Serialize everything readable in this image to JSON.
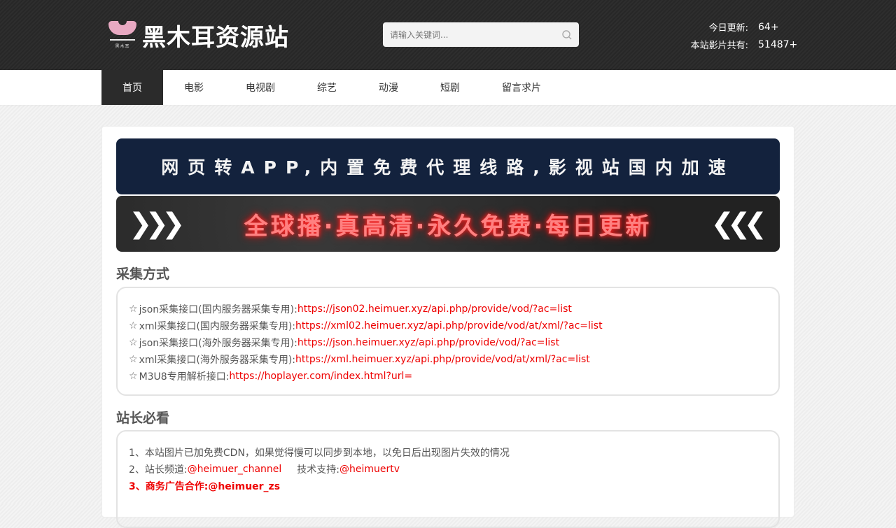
{
  "header": {
    "logo_text": "黑木耳资源站",
    "logo_mini_text": "黑木耳",
    "search_placeholder": "请输入关键词...",
    "stats": [
      {
        "label": "今日更新:",
        "value": "64+"
      },
      {
        "label": "本站影片共有:",
        "value": "51487+"
      }
    ]
  },
  "nav": {
    "items": [
      {
        "label": "首页",
        "active": true
      },
      {
        "label": "电影",
        "active": false
      },
      {
        "label": "电视剧",
        "active": false
      },
      {
        "label": "综艺",
        "active": false
      },
      {
        "label": "动漫",
        "active": false
      },
      {
        "label": "短剧",
        "active": false
      },
      {
        "label": "留言求片",
        "active": false
      }
    ]
  },
  "banners": {
    "banner1_text": "网页转APP,内置免费代理线路,影视站国内加速",
    "banner2_text": "全球播·真高清·永久免费·每日更新",
    "banner1_bg": "#13223d",
    "banner2_text_color": "#ff8080"
  },
  "collect": {
    "title": "采集方式",
    "items": [
      {
        "star": "☆",
        "label": "json采集接口(国内服务器采集专用):",
        "url": "https://json02.heimuer.xyz/api.php/provide/vod/?ac=list"
      },
      {
        "star": "☆",
        "label": "xml采集接口(国内服务器采集专用):",
        "url": "https://xml02.heimuer.xyz/api.php/provide/vod/at/xml/?ac=list"
      },
      {
        "star": "☆",
        "label": "json采集接口(海外服务器采集专用):",
        "url": "https://json.heimuer.xyz/api.php/provide/vod/?ac=list"
      },
      {
        "star": "☆",
        "label": "xml采集接口(海外服务器采集专用):",
        "url": "https://xml.heimuer.xyz/api.php/provide/vod/at/xml/?ac=list"
      },
      {
        "star": "☆",
        "label": "M3U8专用解析接口:",
        "url": "https://hoplayer.com/index.html?url="
      }
    ]
  },
  "notes": {
    "title": "站长必看",
    "line1": "1、本站图片已加免费CDN，如果觉得慢可以同步到本地，以免日后出现图片失效的情况",
    "line2_prefix": "2、站长频道:",
    "line2_channel": "@heimuer_channel",
    "line2_support_label": "技术支持:",
    "line2_support": "@heimuertv",
    "line3": "3、商务广告合作:@heimuer_zs"
  },
  "colors": {
    "link": "#ee0000",
    "topbar": "#2b2b2b",
    "nav_active": "#2b2b2b"
  }
}
